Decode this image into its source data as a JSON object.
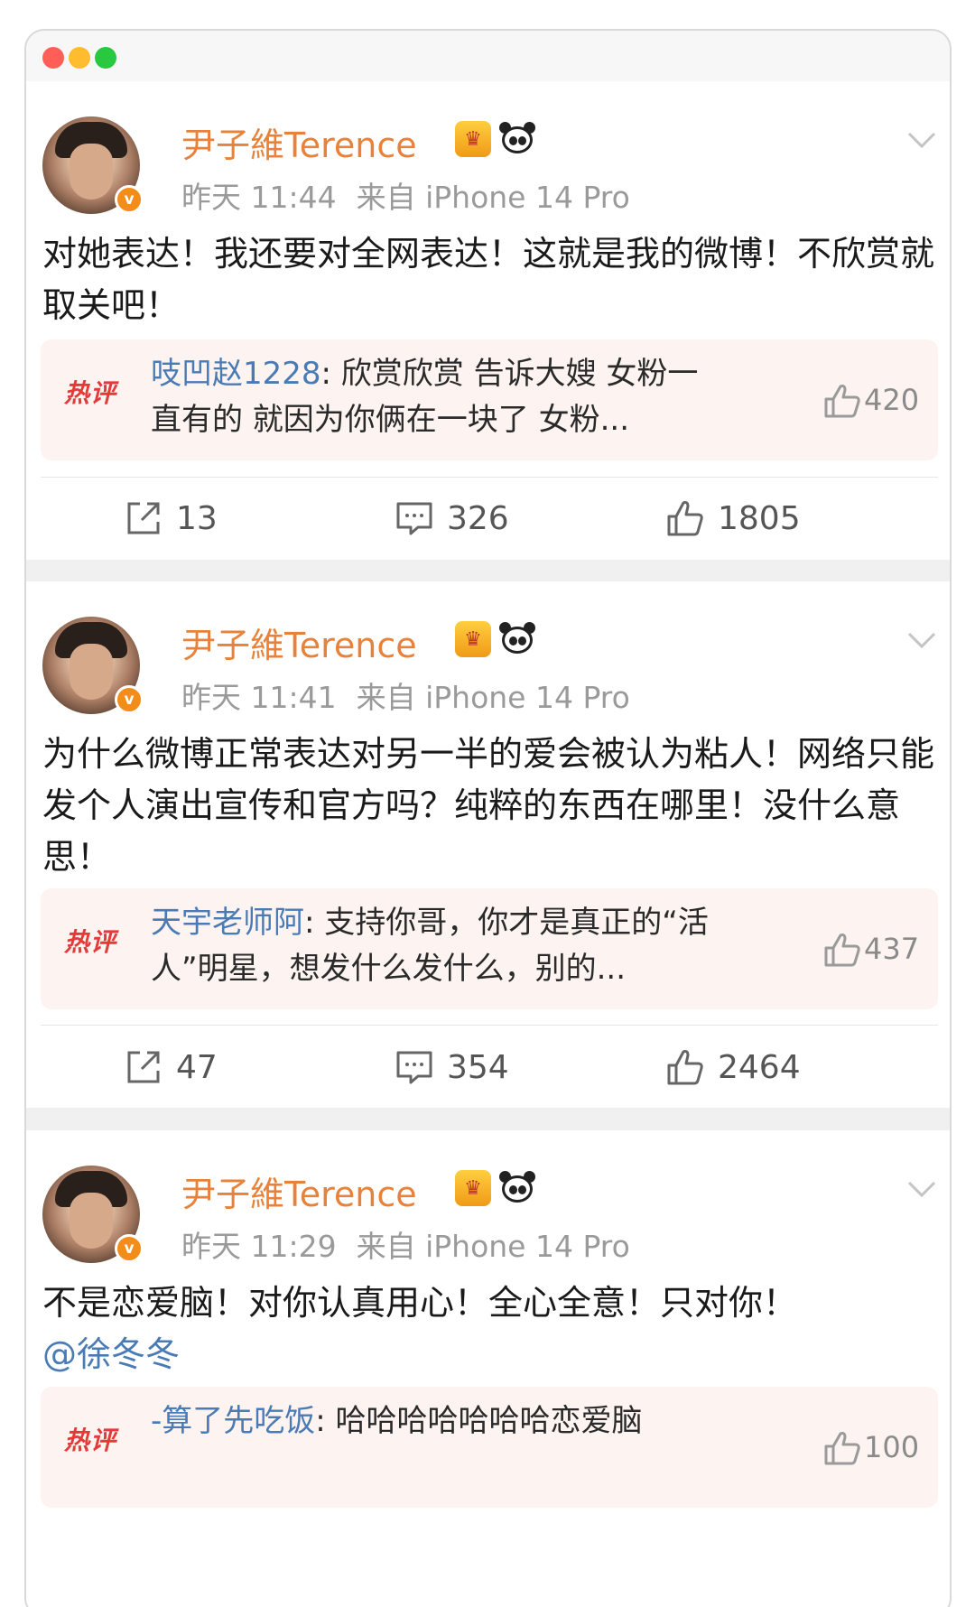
{
  "window": {
    "controls": [
      "close",
      "minimize",
      "zoom"
    ]
  },
  "posts": [
    {
      "username": "尹子維Terence",
      "badges": [
        "crown-icon",
        "panda-icon"
      ],
      "time": "昨天 11:44",
      "source": "来自 iPhone 14 Pro",
      "text": "对她表达！我还要对全网表达！这就是我的微博！不欣赏就取关吧！",
      "hot_comment": {
        "badge": "热评",
        "commenter": "吱凹赵1228",
        "text": "欣赏欣赏 告诉大嫂 女粉一直有的 就因为你俩在一块了 女粉...",
        "likes": "420"
      },
      "actions": {
        "reposts": "13",
        "comments": "326",
        "likes": "1805"
      }
    },
    {
      "username": "尹子維Terence",
      "badges": [
        "crown-icon",
        "panda-icon"
      ],
      "time": "昨天 11:41",
      "source": "来自 iPhone 14 Pro",
      "text": "为什么微博正常表达对另一半的爱会被认为粘人！网络只能发个人演出宣传和官方吗？纯粹的东西在哪里！没什么意思！",
      "hot_comment": {
        "badge": "热评",
        "commenter": "天宇老师阿",
        "text": "支持你哥，你才是真正的“活人”明星，想发什么发什么，别的...",
        "likes": "437"
      },
      "actions": {
        "reposts": "47",
        "comments": "354",
        "likes": "2464"
      }
    },
    {
      "username": "尹子維Terence",
      "badges": [
        "crown-icon",
        "panda-icon"
      ],
      "time": "昨天 11:29",
      "source": "来自 iPhone 14 Pro",
      "text": "不是恋爱脑！对你认真用心！全心全意！只对你！",
      "mention": "@徐冬冬",
      "hot_comment": {
        "badge": "热评",
        "commenter": "-算了先吃饭",
        "text": "哈哈哈哈哈哈哈恋爱脑",
        "likes": "100"
      }
    }
  ],
  "colors": {
    "username": "#e8823a",
    "link": "#4a7bb5",
    "hot_badge": "#e53a3a",
    "meta": "#9a9a9a"
  }
}
